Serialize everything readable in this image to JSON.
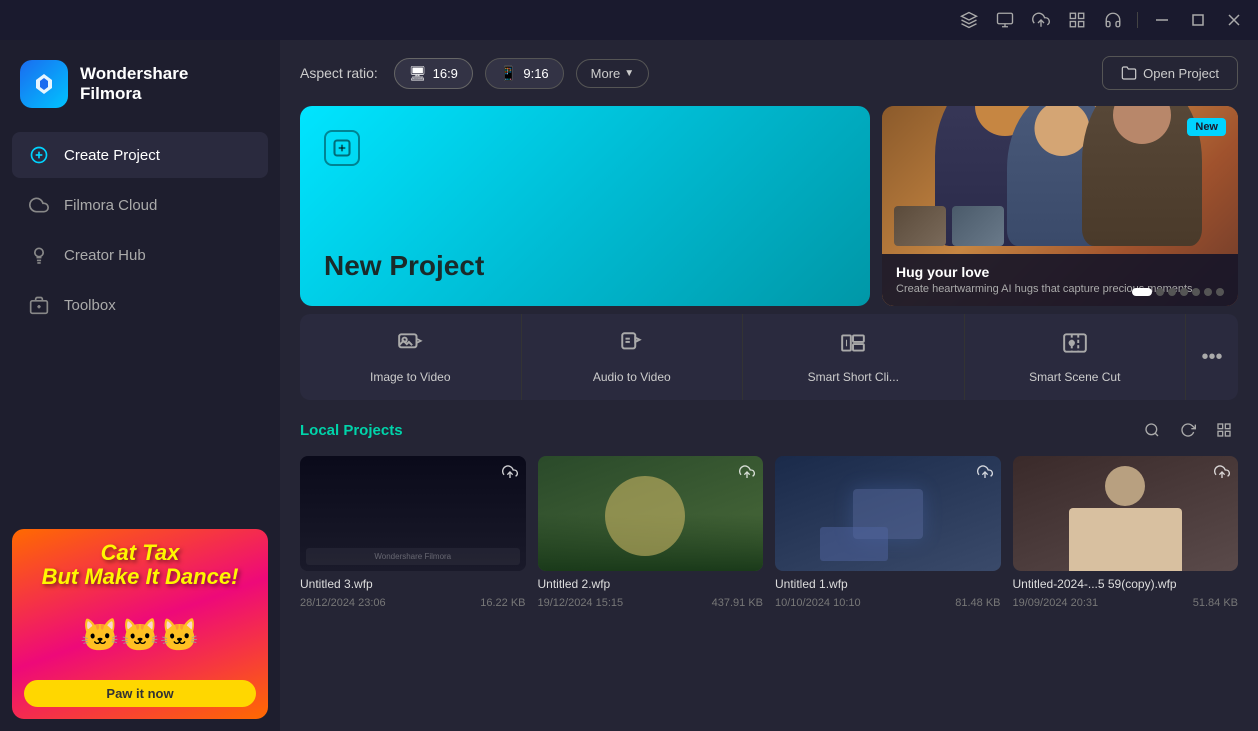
{
  "titlebar": {
    "icons": [
      "gear-pencil",
      "screen-share",
      "cloud-upload",
      "grid-apps",
      "headphones"
    ],
    "controls": [
      "minimize",
      "maximize",
      "close"
    ]
  },
  "sidebar": {
    "logo": {
      "title": "Wondershare",
      "subtitle": "Filmora"
    },
    "nav_items": [
      {
        "id": "create-project",
        "label": "Create Project",
        "icon": "plus-circle",
        "active": true
      },
      {
        "id": "filmora-cloud",
        "label": "Filmora Cloud",
        "icon": "cloud"
      },
      {
        "id": "creator-hub",
        "label": "Creator Hub",
        "icon": "lightbulb"
      },
      {
        "id": "toolbox",
        "label": "Toolbox",
        "icon": "toolbox"
      }
    ],
    "ad": {
      "title": "Cat Tax\nBut Make It Dance!",
      "button_label": "Paw it now"
    }
  },
  "aspect_ratio": {
    "label": "Aspect ratio:",
    "options": [
      {
        "id": "16-9",
        "label": "16:9",
        "icon": "monitor",
        "active": true
      },
      {
        "id": "9-16",
        "label": "9:16",
        "icon": "mobile"
      }
    ],
    "more_label": "More",
    "open_project_label": "Open Project"
  },
  "new_project": {
    "label": "New Project"
  },
  "feature_carousel": {
    "badge": "New",
    "title": "Hug your love",
    "description": "Create heartwarming AI hugs that capture precious moments.",
    "dots": [
      true,
      false,
      false,
      false,
      false,
      false,
      false
    ]
  },
  "tools": [
    {
      "id": "image-to-video",
      "label": "Image to Video",
      "icon": "image-play"
    },
    {
      "id": "audio-to-video",
      "label": "Audio to Video",
      "icon": "audio-play"
    },
    {
      "id": "smart-short-clip",
      "label": "Smart Short Cli...",
      "icon": "clip-smart"
    },
    {
      "id": "smart-scene-cut",
      "label": "Smart Scene Cut",
      "icon": "scene-cut"
    },
    {
      "id": "more",
      "label": "...",
      "icon": "ellipsis"
    }
  ],
  "local_projects": {
    "title": "Local Projects",
    "projects": [
      {
        "id": "untitled-3",
        "name": "Untitled 3.wfp",
        "date": "28/12/2024 23:06",
        "size": "16.22 KB",
        "thumb_type": "dark"
      },
      {
        "id": "untitled-2",
        "name": "Untitled 2.wfp",
        "date": "19/12/2024 15:15",
        "size": "437.91 KB",
        "thumb_type": "nature"
      },
      {
        "id": "untitled-1",
        "name": "Untitled 1.wfp",
        "date": "10/10/2024 10:10",
        "size": "81.48 KB",
        "thumb_type": "blue"
      },
      {
        "id": "untitled-copy",
        "name": "Untitled-2024-...5 59(copy).wfp",
        "date": "19/09/2024 20:31",
        "size": "51.84 KB",
        "thumb_type": "person"
      }
    ]
  }
}
